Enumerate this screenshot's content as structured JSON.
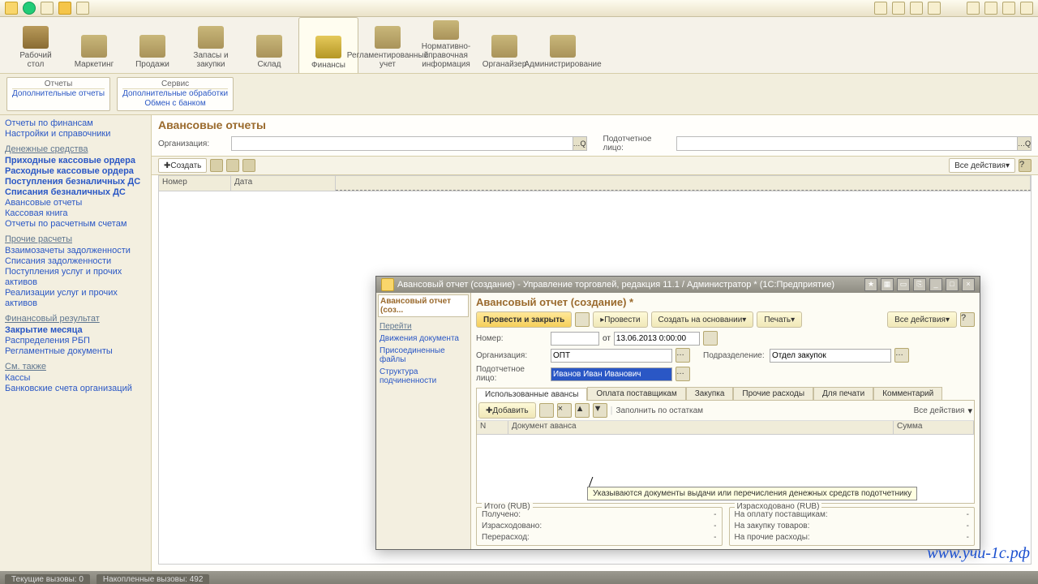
{
  "ribbon": [
    {
      "label": "Рабочий\nстол"
    },
    {
      "label": "Маркетинг"
    },
    {
      "label": "Продажи"
    },
    {
      "label": "Запасы и\nзакупки"
    },
    {
      "label": "Склад"
    },
    {
      "label": "Финансы",
      "active": true
    },
    {
      "label": "Регламентированный\nучет"
    },
    {
      "label": "Нормативно-справочная\nинформация"
    },
    {
      "label": "Органайзер"
    },
    {
      "label": "Администрирование"
    }
  ],
  "subribbon": [
    {
      "header": "Отчеты",
      "lines": [
        "Дополнительные отчеты"
      ]
    },
    {
      "header": "Сервис",
      "lines": [
        "Дополнительные обработки",
        "Обмен с банком"
      ]
    }
  ],
  "sidebar": {
    "top_links": [
      "Отчеты по финансам",
      "Настройки и справочники"
    ],
    "g1": {
      "title": "Денежные средства",
      "links": [
        {
          "t": "Приходные кассовые ордера",
          "b": true
        },
        {
          "t": "Расходные кассовые ордера",
          "b": true
        },
        {
          "t": "Поступления безналичных ДС",
          "b": true
        },
        {
          "t": "Списания безналичных ДС",
          "b": true
        },
        {
          "t": "Авансовые отчеты"
        },
        {
          "t": "Кассовая книга"
        },
        {
          "t": "Отчеты по расчетным счетам"
        }
      ]
    },
    "g2": {
      "title": "Прочие расчеты",
      "links": [
        {
          "t": "Взаимозачеты задолженности"
        },
        {
          "t": "Списания задолженности"
        },
        {
          "t": "Поступления услуг и прочих активов"
        },
        {
          "t": "Реализации услуг и прочих активов"
        }
      ]
    },
    "g3": {
      "title": "Финансовый результат",
      "links": [
        {
          "t": "Закрытие месяца",
          "b": true
        },
        {
          "t": "Распределения РБП"
        },
        {
          "t": "Регламентные документы"
        }
      ]
    },
    "g4": {
      "title": "См. также",
      "links": [
        {
          "t": "Кассы"
        },
        {
          "t": "Банковские счета организаций"
        }
      ]
    }
  },
  "main": {
    "title": "Авансовые отчеты",
    "filter1_label": "Организация:",
    "filter2_label": "Подотчетное лицо:",
    "create": "Создать",
    "all_actions": "Все действия",
    "cols": [
      "Номер",
      "Дата"
    ]
  },
  "modal": {
    "window_title": "Авансовый отчет (создание) - Управление торговлей, редакция 11.1 / Администратор * (1С:Предприятие)",
    "nav": [
      {
        "t": "Авансовый отчет (соз...",
        "active": true
      },
      {
        "t": "Перейти",
        "h": true
      },
      {
        "t": "Движения документа"
      },
      {
        "t": "Присоединенные файлы"
      },
      {
        "t": "Структура подчиненности"
      }
    ],
    "title": "Авансовый отчет (создание) *",
    "btn_post_close": "Провести и закрыть",
    "btn_post": "Провести",
    "btn_create_based": "Создать на основании",
    "btn_print": "Печать",
    "all_actions": "Все действия",
    "f_number": "Номер:",
    "f_from": "от",
    "f_date": "13.06.2013 0:00:00",
    "f_org": "Организация:",
    "v_org": "ОПТ",
    "f_dept": "Подразделение:",
    "v_dept": "Отдел закупок",
    "f_person": "Подотчетное лицо:",
    "v_person": "Иванов Иван Иванович",
    "tabs": [
      "Использованные авансы",
      "Оплата поставщикам",
      "Закупка",
      "Прочие расходы",
      "Для печати",
      "Комментарий"
    ],
    "grid_btn_add": "Добавить",
    "grid_btn_fill": "Заполнить по остаткам",
    "grid_all_actions": "Все действия",
    "grid_cols": {
      "n": "N",
      "doc": "Документ аванса",
      "sum": "Сумма"
    },
    "tooltip": "Указываются документы выдачи или перечисления денежных средств подотчетнику",
    "box1": {
      "legend": "Итого (RUB)",
      "lines": [
        "Получено:",
        "Израсходовано:",
        "Перерасход:"
      ]
    },
    "box2": {
      "legend": "Израсходовано (RUB)",
      "lines": [
        "На оплату поставщикам:",
        "На закупку товаров:",
        "На прочие расходы:"
      ]
    }
  },
  "statusbar": {
    "tab1": "Текущие вызовы: 0",
    "tab2": "Накопленные вызовы: 492"
  },
  "watermark": "www.учи-1с.рф"
}
